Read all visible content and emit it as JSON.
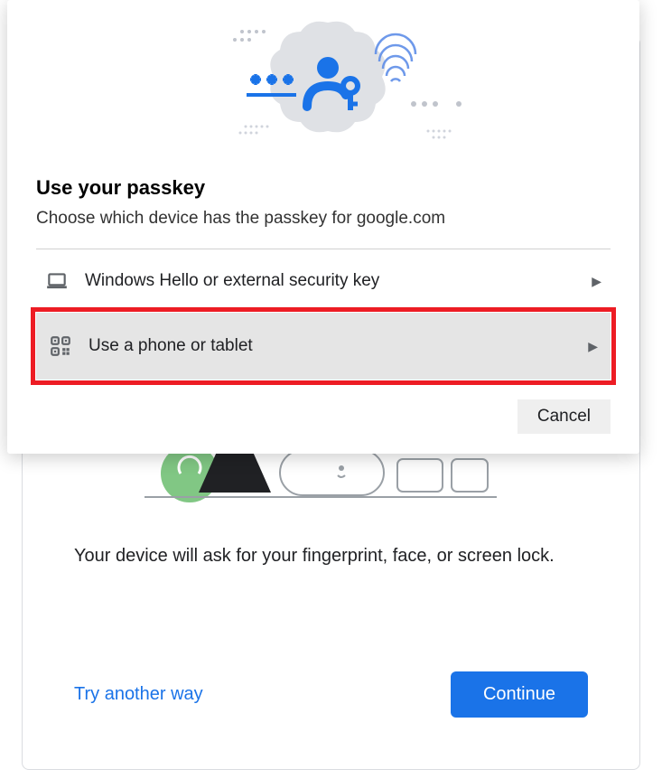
{
  "modal": {
    "title": "Use your passkey",
    "subtitle": "Choose which device has the passkey for google.com",
    "options": [
      {
        "icon": "laptop",
        "label": "Windows Hello or external security key"
      },
      {
        "icon": "qr",
        "label": "Use a phone or tablet"
      }
    ],
    "cancel_label": "Cancel"
  },
  "background": {
    "description": "Your device will ask for your fingerprint, face, or screen lock.",
    "try_another_label": "Try another way",
    "continue_label": "Continue"
  }
}
